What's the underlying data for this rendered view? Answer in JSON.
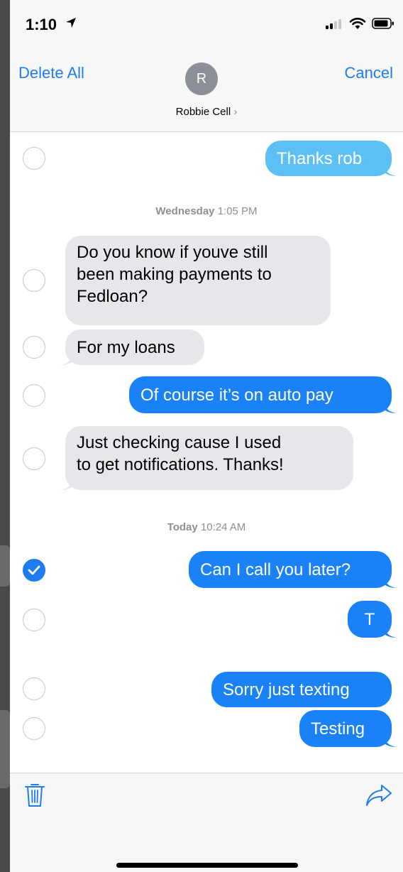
{
  "status_bar": {
    "time": "1:10"
  },
  "header": {
    "delete_all_label": "Delete All",
    "cancel_label": "Cancel",
    "avatar_initial": "R",
    "contact_name": "Robbie Cell",
    "contact_chevron": "›"
  },
  "colors": {
    "accent": "#1f7bf0",
    "outgoing_bubble": "#1a82f6",
    "outgoing_sms_light": "#5cc0f5",
    "incoming_bubble": "#e6e6eb"
  },
  "conversation": {
    "timestamps": [
      {
        "day": "Wednesday",
        "time": "1:05 PM"
      },
      {
        "day": "Today",
        "time": "10:24 AM"
      }
    ],
    "messages": [
      {
        "text": "Thanks rob",
        "direction": "outgoing",
        "selected": false
      },
      {
        "lines": [
          "Do you know if youve still",
          "been making payments to",
          "Fedloan?"
        ],
        "direction": "incoming",
        "selected": false
      },
      {
        "text": "For my loans",
        "direction": "incoming",
        "selected": false
      },
      {
        "text": "Of course it’s on auto pay",
        "direction": "outgoing",
        "selected": false
      },
      {
        "lines": [
          "Just checking cause I used",
          "to get notifications. Thanks!"
        ],
        "direction": "incoming",
        "selected": false
      },
      {
        "text": "Can I call you later?",
        "direction": "outgoing",
        "selected": true
      },
      {
        "text": "T",
        "direction": "outgoing",
        "selected": false
      },
      {
        "text": "Sorry just texting",
        "direction": "outgoing",
        "selected": false
      },
      {
        "text": "Testing",
        "direction": "outgoing",
        "selected": false
      }
    ]
  },
  "toolbar": {
    "left_icon": "trash-icon",
    "right_icon": "share-forward-icon"
  }
}
